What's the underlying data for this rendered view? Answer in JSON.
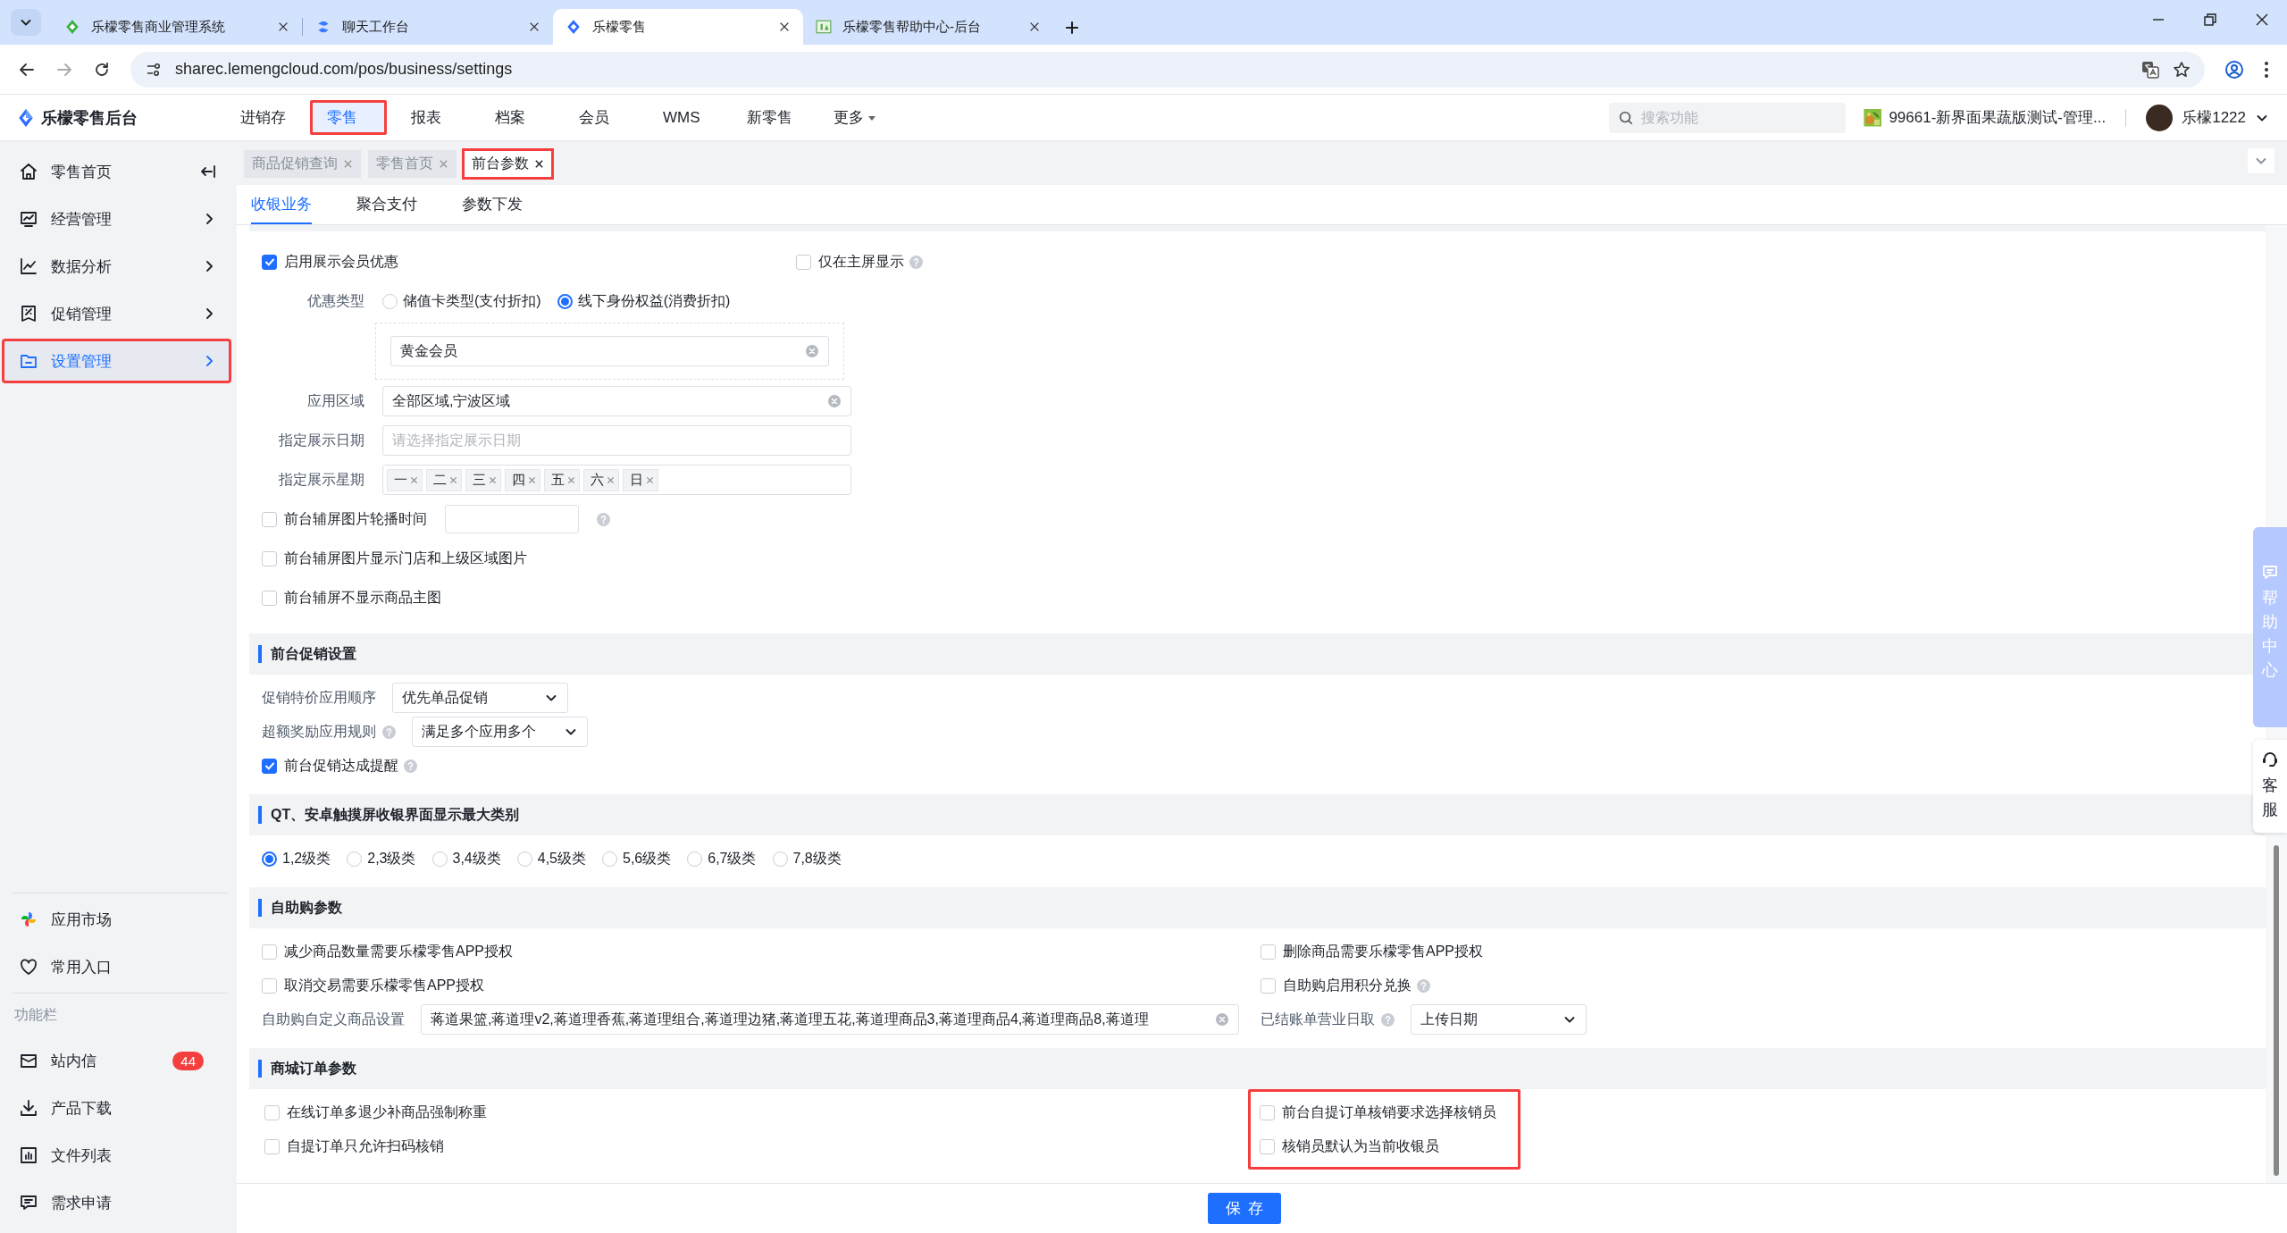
{
  "browser": {
    "tabs": [
      {
        "title": "乐檬零售商业管理系统",
        "selected": false
      },
      {
        "title": "聊天工作台",
        "selected": false
      },
      {
        "title": "乐檬零售",
        "selected": true
      },
      {
        "title": "乐檬零售帮助中心-后台",
        "selected": false
      }
    ],
    "address": "sharec.lemengcloud.com/pos/business/settings"
  },
  "header": {
    "logo": "乐檬零售后台",
    "nav": [
      {
        "label": "进销存",
        "selected": false,
        "highlighted": false,
        "dropdown": false
      },
      {
        "label": "零售",
        "selected": true,
        "highlighted": true,
        "dropdown": false
      },
      {
        "label": "报表",
        "selected": false,
        "highlighted": false,
        "dropdown": false
      },
      {
        "label": "档案",
        "selected": false,
        "highlighted": false,
        "dropdown": false
      },
      {
        "label": "会员",
        "selected": false,
        "highlighted": false,
        "dropdown": false
      },
      {
        "label": "WMS",
        "selected": false,
        "highlighted": false,
        "dropdown": false
      },
      {
        "label": "新零售",
        "selected": false,
        "highlighted": false,
        "dropdown": false
      },
      {
        "label": "更多",
        "selected": false,
        "highlighted": false,
        "dropdown": true
      }
    ],
    "search": {
      "placeholder": "搜索功能"
    },
    "store": "99661-新界面果蔬版测试-管理...",
    "user": "乐檬1222"
  },
  "sidebar": {
    "items": [
      {
        "label": "零售首页",
        "selected": false,
        "highlighted": false,
        "expandable": false
      },
      {
        "label": "经营管理",
        "selected": false,
        "highlighted": false,
        "expandable": true
      },
      {
        "label": "数据分析",
        "selected": false,
        "highlighted": false,
        "expandable": true
      },
      {
        "label": "促销管理",
        "selected": false,
        "highlighted": false,
        "expandable": true
      },
      {
        "label": "设置管理",
        "selected": true,
        "highlighted": true,
        "expandable": true
      }
    ],
    "apps": [
      {
        "label": "应用市场"
      },
      {
        "label": "常用入口"
      }
    ],
    "section_title": "功能栏",
    "tools": [
      {
        "label": "站内信",
        "badge": "44"
      },
      {
        "label": "产品下载"
      },
      {
        "label": "文件列表"
      },
      {
        "label": "需求申请"
      }
    ]
  },
  "page_tabs": [
    {
      "label": "商品促销查询",
      "selected": false,
      "highlighted": false
    },
    {
      "label": "零售首页",
      "selected": false,
      "highlighted": false
    },
    {
      "label": "前台参数",
      "selected": true,
      "highlighted": true
    }
  ],
  "sub_tabs": [
    {
      "label": "收银业务",
      "selected": true
    },
    {
      "label": "聚合支付",
      "selected": false
    },
    {
      "label": "参数下发",
      "selected": false
    }
  ],
  "form": {
    "sections": [
      {
        "rows": [
          {
            "items": [
              {
                "kind": "checkbox",
                "label": "启用展示会员优惠",
                "checked": true,
                "help": false
              },
              {
                "kind": "checkbox",
                "label": "仅在主屏显示",
                "checked": false,
                "help": true
              }
            ]
          },
          {
            "items": [
              {
                "kind": "radios",
                "label": "优惠类型",
                "options": [
                  {
                    "label": "储值卡类型(支付折扣)",
                    "selected": false
                  },
                  {
                    "label": "线下身份权益(消费折扣)",
                    "selected": true
                  }
                ]
              }
            ]
          },
          {
            "items": [
              {
                "kind": "boxed-field",
                "value": "黄金会员",
                "clearable": true
              }
            ]
          },
          {
            "items": [
              {
                "kind": "field",
                "label": "应用区域",
                "value": "全部区域,宁波区域",
                "clearable": true
              }
            ]
          },
          {
            "items": [
              {
                "kind": "field",
                "label": "指定展示日期",
                "placeholder": "请选择指定展示日期",
                "clearable": false
              }
            ]
          },
          {
            "items": [
              {
                "kind": "tags",
                "label": "指定展示星期",
                "tags": [
                  "一",
                  "二",
                  "三",
                  "四",
                  "五",
                  "六",
                  "日"
                ]
              }
            ]
          },
          {
            "items": [
              {
                "kind": "checkbox-with-input",
                "label": "前台辅屏图片轮播时间",
                "checked": false
              }
            ]
          },
          {
            "items": [
              {
                "kind": "checkbox",
                "label": "前台辅屏图片显示门店和上级区域图片",
                "checked": false,
                "help": false
              }
            ]
          },
          {
            "items": [
              {
                "kind": "checkbox",
                "label": "前台辅屏不显示商品主图",
                "checked": false,
                "help": false
              }
            ]
          }
        ]
      },
      {
        "title": "前台促销设置",
        "rows": [
          {
            "items": [
              {
                "kind": "select",
                "label": "促销特价应用顺序",
                "value": "优先单品促销",
                "help": false
              }
            ]
          },
          {
            "items": [
              {
                "kind": "select",
                "label": "超额奖励应用规则",
                "value": "满足多个应用多个",
                "help": true
              }
            ]
          },
          {
            "items": [
              {
                "kind": "checkbox",
                "label": "前台促销达成提醒",
                "checked": true,
                "help": true
              }
            ]
          }
        ]
      },
      {
        "title": "QT、安卓触摸屏收银界面显示最大类别",
        "rows": [
          {
            "items": [
              {
                "kind": "radios",
                "options": [
                  {
                    "label": "1,2级类",
                    "selected": true
                  },
                  {
                    "label": "2,3级类",
                    "selected": false
                  },
                  {
                    "label": "3,4级类",
                    "selected": false
                  },
                  {
                    "label": "4,5级类",
                    "selected": false
                  },
                  {
                    "label": "5,6级类",
                    "selected": false
                  },
                  {
                    "label": "6,7级类",
                    "selected": false
                  },
                  {
                    "label": "7,8级类",
                    "selected": false
                  }
                ]
              }
            ]
          }
        ]
      },
      {
        "title": "自助购参数",
        "rows": [
          {
            "items": [
              {
                "kind": "checkbox",
                "label": "减少商品数量需要乐檬零售APP授权",
                "checked": false,
                "help": false
              },
              {
                "kind": "checkbox",
                "label": "删除商品需要乐檬零售APP授权",
                "checked": false,
                "help": false
              }
            ]
          },
          {
            "items": [
              {
                "kind": "checkbox",
                "label": "取消交易需要乐檬零售APP授权",
                "checked": false,
                "help": false
              },
              {
                "kind": "checkbox",
                "label": "自助购启用积分兑换",
                "checked": false,
                "help": true
              }
            ]
          },
          {
            "items": [
              {
                "kind": "field",
                "label": "自助购自定义商品设置",
                "value": "蒋道果篮,蒋道理v2,蒋道理香蕉,蒋道理组合,蒋道理边猪,蒋道理五花,蒋道理商品3,蒋道理商品4,蒋道理商品8,蒋道理",
                "clearable": true
              },
              {
                "kind": "select",
                "label": "已结账单营业日取",
                "value": "上传日期",
                "help": true
              }
            ]
          }
        ]
      },
      {
        "title": "商城订单参数",
        "columns": [
          {
            "items": [
              {
                "kind": "checkbox",
                "label": "在线订单多退少补商品强制称重",
                "checked": false,
                "help": false
              },
              {
                "kind": "checkbox",
                "label": "自提订单只允许扫码核销",
                "checked": false,
                "help": false
              }
            ]
          },
          {
            "highlighted": true,
            "items": [
              {
                "kind": "checkbox",
                "label": "前台自提订单核销要求选择核销员",
                "checked": false,
                "help": false
              },
              {
                "kind": "checkbox",
                "label": "核销员默认为当前收银员",
                "checked": false,
                "help": false
              }
            ]
          }
        ]
      }
    ]
  },
  "save_button": "保存",
  "float_tabs": [
    {
      "label": "帮助中心",
      "selected": true
    },
    {
      "label": "客服",
      "selected": false
    }
  ]
}
